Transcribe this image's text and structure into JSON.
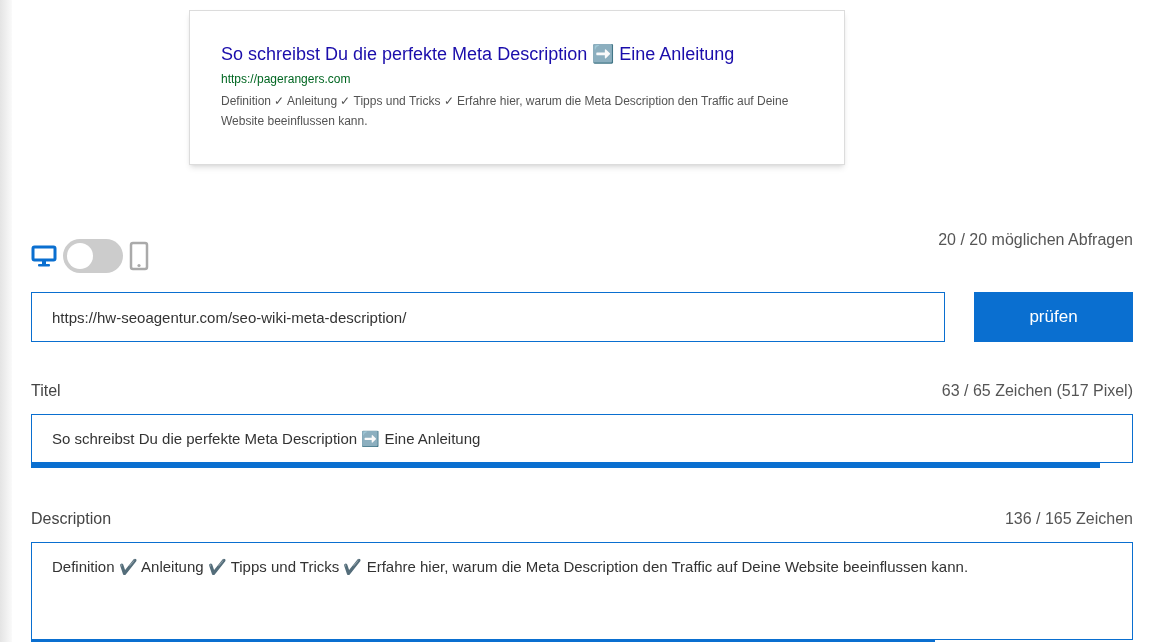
{
  "snippet": {
    "title": "So schreibst Du die perfekte Meta Description ➡️ Eine Anleitung",
    "url": "https://pagerangers.com",
    "description": "Definition ✓ Anleitung ✓ Tipps und Tricks ✓ Erfahre hier, warum die Meta Description den Traffic auf Deine Website beeinflussen kann."
  },
  "device": {
    "mobile": false,
    "queries": "20 / 20 möglichen Abfragen"
  },
  "url_field": {
    "value": "https://hw-seoagentur.com/seo-wiki-meta-description/"
  },
  "check_button": "prüfen",
  "title_field": {
    "label": "Titel",
    "count": "63 / 65 Zeichen (517 Pixel)",
    "value": "So schreibst Du die perfekte Meta Description ➡️ Eine Anleitung",
    "level": 0.97
  },
  "description_field": {
    "label": "Description",
    "count": "136 / 165 Zeichen",
    "value": "Definition ✔️ Anleitung ✔️ Tipps und Tricks ✔️ Erfahre hier, warum die Meta Description den Traffic auf Deine Website beeinflussen kann.",
    "level": 0.82
  }
}
